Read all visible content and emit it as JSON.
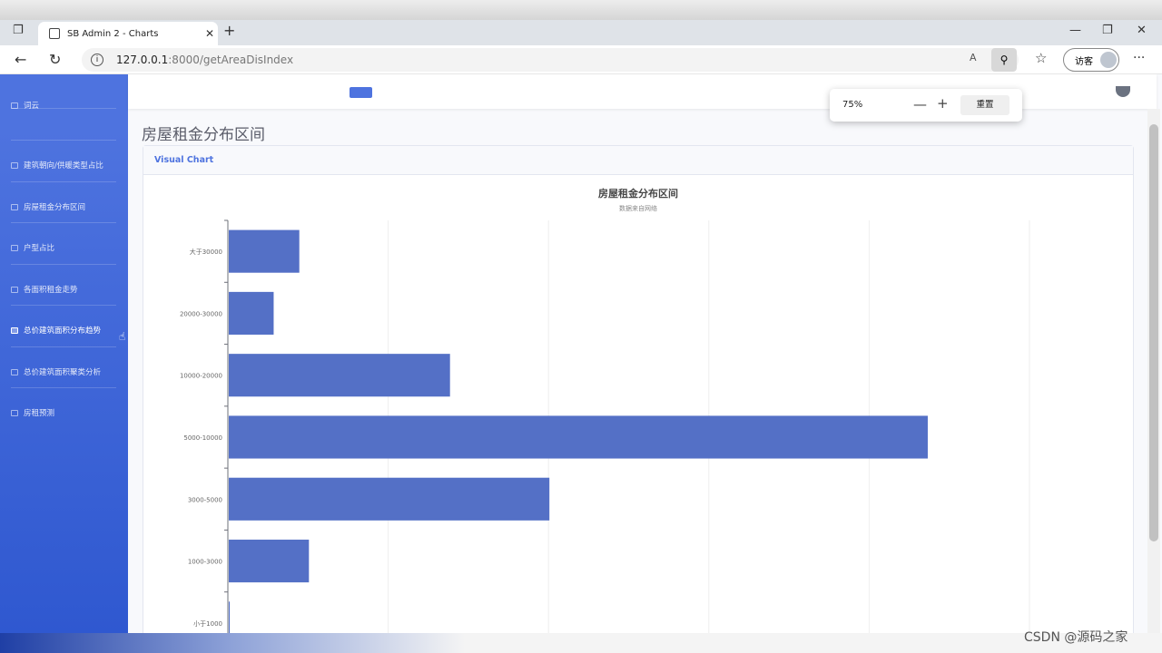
{
  "browser": {
    "tab_title": "SB Admin 2 - Charts",
    "close_tab": "✕",
    "new_tab": "+",
    "url_host": "127.0.0.1",
    "url_rest": ":8000/getAreaDisIndex",
    "profile_label": "访客",
    "zoom_popup": {
      "value": "75%",
      "minus": "—",
      "plus": "+",
      "reset_label": "重置"
    }
  },
  "sidebar": {
    "items": [
      {
        "label": "词云"
      },
      {
        "label": "建筑朝向/供暖类型占比"
      },
      {
        "label": "房屋租金分布区间"
      },
      {
        "label": "户型占比"
      },
      {
        "label": "各面积租金走势"
      },
      {
        "label": "总价建筑面积分布趋势"
      },
      {
        "label": "总价建筑面积聚类分析"
      },
      {
        "label": "房租预测"
      }
    ]
  },
  "main": {
    "heading": "房屋租金分布区间",
    "card_title": "Visual Chart"
  },
  "chart_data": {
    "type": "bar",
    "orientation": "horizontal",
    "title": "房屋租金分布区间",
    "subtitle": "数据来自网络",
    "categories": [
      "大于30000",
      "20000-30000",
      "10000-20000",
      "5000-10000",
      "3000-5000",
      "1000-3000",
      "小于1000"
    ],
    "values": [
      22,
      14,
      69,
      218,
      100,
      25,
      0.3
    ],
    "xlim": [
      0,
      250
    ],
    "grid": true,
    "bar_color": "#5470c6"
  },
  "watermark": "CSDN @源码之家"
}
